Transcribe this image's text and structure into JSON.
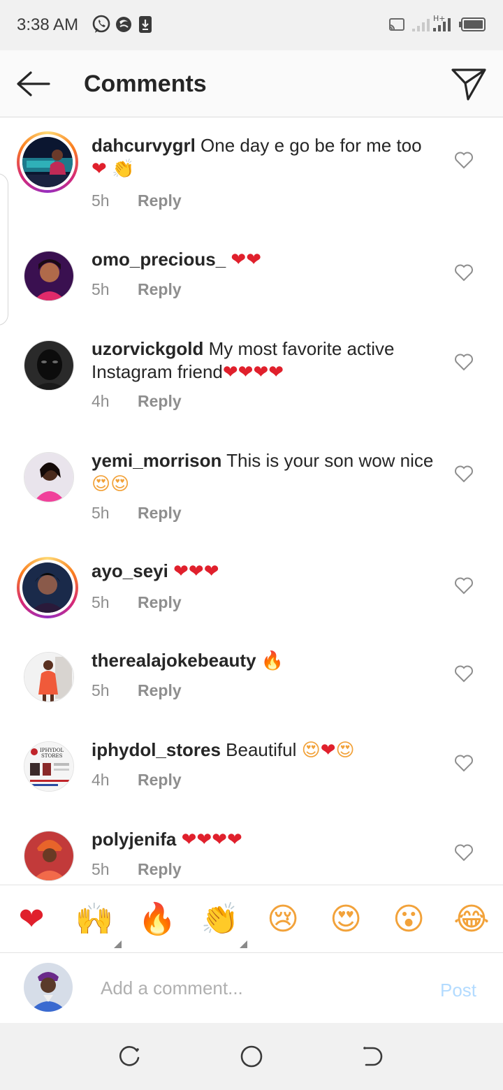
{
  "status_bar": {
    "time": "3:38 AM",
    "left_icons": [
      "whatsapp-icon",
      "app-notification-icon",
      "download-icon"
    ],
    "right_icons": [
      "cast-icon",
      "signal-icon",
      "signal-h-plus-icon",
      "battery-icon"
    ]
  },
  "header": {
    "title": "Comments",
    "back_icon": "arrow-left-icon",
    "share_icon": "send-icon"
  },
  "comments": [
    {
      "username": "dahcurvygrl",
      "text": " One day e go be for me too ",
      "emojis": [
        "❤",
        "👏"
      ],
      "time": "5h",
      "reply": "Reply",
      "story_ring": true
    },
    {
      "username": "omo_precious_",
      "text": " ",
      "emojis": [
        "❤",
        "❤"
      ],
      "time": "5h",
      "reply": "Reply",
      "story_ring": false
    },
    {
      "username": "uzorvickgold",
      "text": " My most favorite active Instagram friend",
      "emojis": [
        "❤",
        "❤",
        "❤",
        "❤"
      ],
      "time": "4h",
      "reply": "Reply",
      "story_ring": false
    },
    {
      "username": "yemi_morrison",
      "text": " This is your son wow nice",
      "emojis": [
        "😍",
        "😍"
      ],
      "time": "5h",
      "reply": "Reply",
      "story_ring": false
    },
    {
      "username": "ayo_seyi",
      "text": " ",
      "emojis": [
        "❤",
        "❤",
        "❤"
      ],
      "time": "5h",
      "reply": "Reply",
      "story_ring": true
    },
    {
      "username": "therealajokebeauty",
      "text": " ",
      "emojis": [
        "🔥"
      ],
      "time": "5h",
      "reply": "Reply",
      "story_ring": false
    },
    {
      "username": "iphydol_stores",
      "text": " Beautiful ",
      "emojis": [
        "😍",
        "❤",
        "😍"
      ],
      "time": "4h",
      "reply": "Reply",
      "story_ring": false,
      "avatar_text": "IPHYDOL STORES"
    },
    {
      "username": "polyjenifa",
      "text": " ",
      "emojis": [
        "❤",
        "❤",
        "❤",
        "❤"
      ],
      "time": "5h",
      "reply": "Reply",
      "story_ring": false
    }
  ],
  "emoji_bar": [
    "❤",
    "🙌",
    "🔥",
    "👏",
    "😢",
    "😍",
    "😮",
    "😂"
  ],
  "compose": {
    "placeholder": "Add a comment...",
    "post_label": "Post"
  },
  "nav_bar": [
    "recent-apps-icon",
    "home-icon",
    "back-icon"
  ],
  "colors": {
    "accent_post_disabled": "#b3dbff",
    "heart_red": "#e0202c",
    "muted_text": "#8e8e8e"
  }
}
